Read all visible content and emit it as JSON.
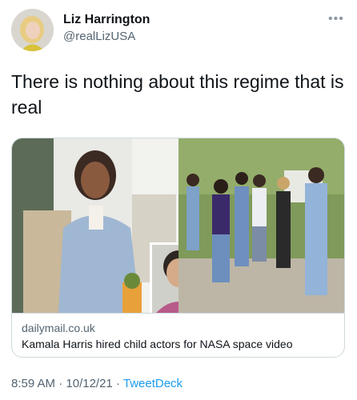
{
  "author": {
    "display_name": "Liz Harrington",
    "handle": "@realLizUSA",
    "avatar_icon": "profile-photo-avatar"
  },
  "more_icon": "more-options-icon",
  "tweet": {
    "text": "There is nothing about this regime that is real"
  },
  "link_card": {
    "domain": "dailymail.co.uk",
    "title": "Kamala Harris hired child actors for NASA space video"
  },
  "footer": {
    "time": "8:59 AM",
    "separator": "·",
    "date": "10/12/21",
    "source": "TweetDeck"
  },
  "colors": {
    "text": "#0f1419",
    "secondary": "#536471",
    "accent": "#1d9bf0",
    "border": "#cfd9de"
  }
}
